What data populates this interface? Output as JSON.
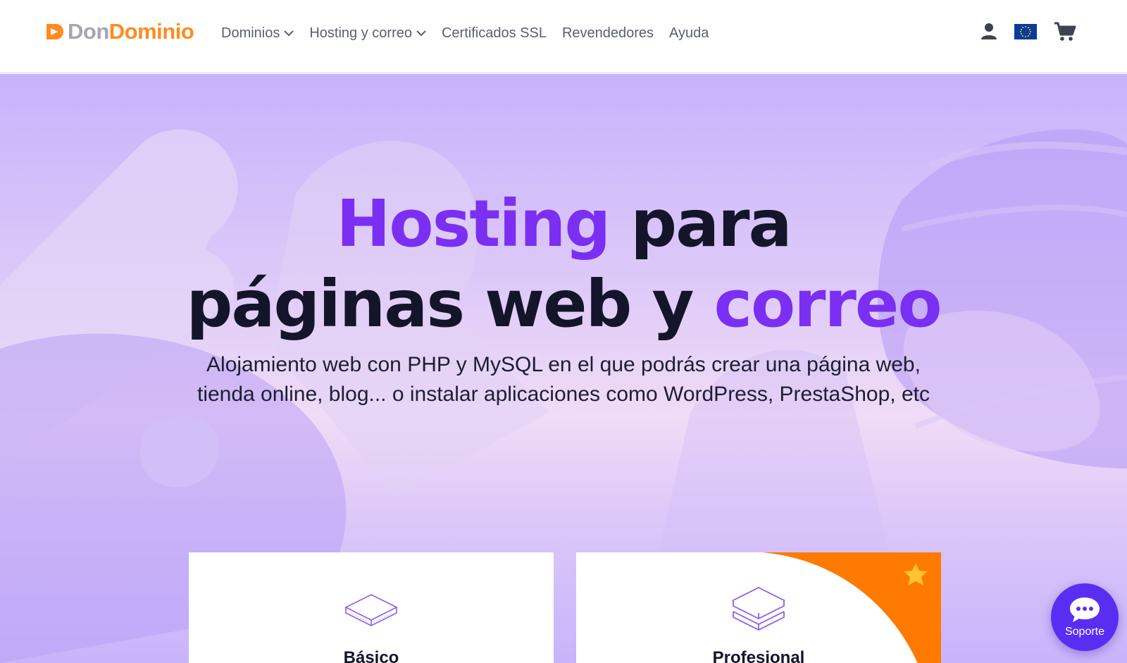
{
  "header": {
    "logo": {
      "part1": "Don",
      "part2": "Dominio"
    },
    "nav": [
      {
        "label": "Dominios",
        "dropdown": true
      },
      {
        "label": "Hosting y correo",
        "dropdown": true
      },
      {
        "label": "Certificados SSL",
        "dropdown": false
      },
      {
        "label": "Revendedores",
        "dropdown": false
      },
      {
        "label": "Ayuda",
        "dropdown": false
      }
    ],
    "icons": [
      "user-icon",
      "eu-flag-icon",
      "cart-icon"
    ]
  },
  "hero": {
    "title_line1_accent": "Hosting",
    "title_line1_rest": " para",
    "title_line2_start": "páginas web y ",
    "title_line2_accent": "correo",
    "subtitle": "Alojamiento web con PHP y MySQL en el que podrás crear una página web, tienda online, blog... o instalar aplicaciones como WordPress, PrestaShop, etc"
  },
  "plans": [
    {
      "name": "Básico",
      "icon": "single-layer-icon"
    },
    {
      "name": "Profesional",
      "icon": "stacked-layers-icon",
      "featured": true
    }
  ],
  "support": {
    "label": "Soporte"
  },
  "colors": {
    "accent": "#7b2ff2",
    "brand_orange": "#ff8b1f",
    "support_bg": "#5a2ef2",
    "nav_text": "#5a5f6e"
  }
}
